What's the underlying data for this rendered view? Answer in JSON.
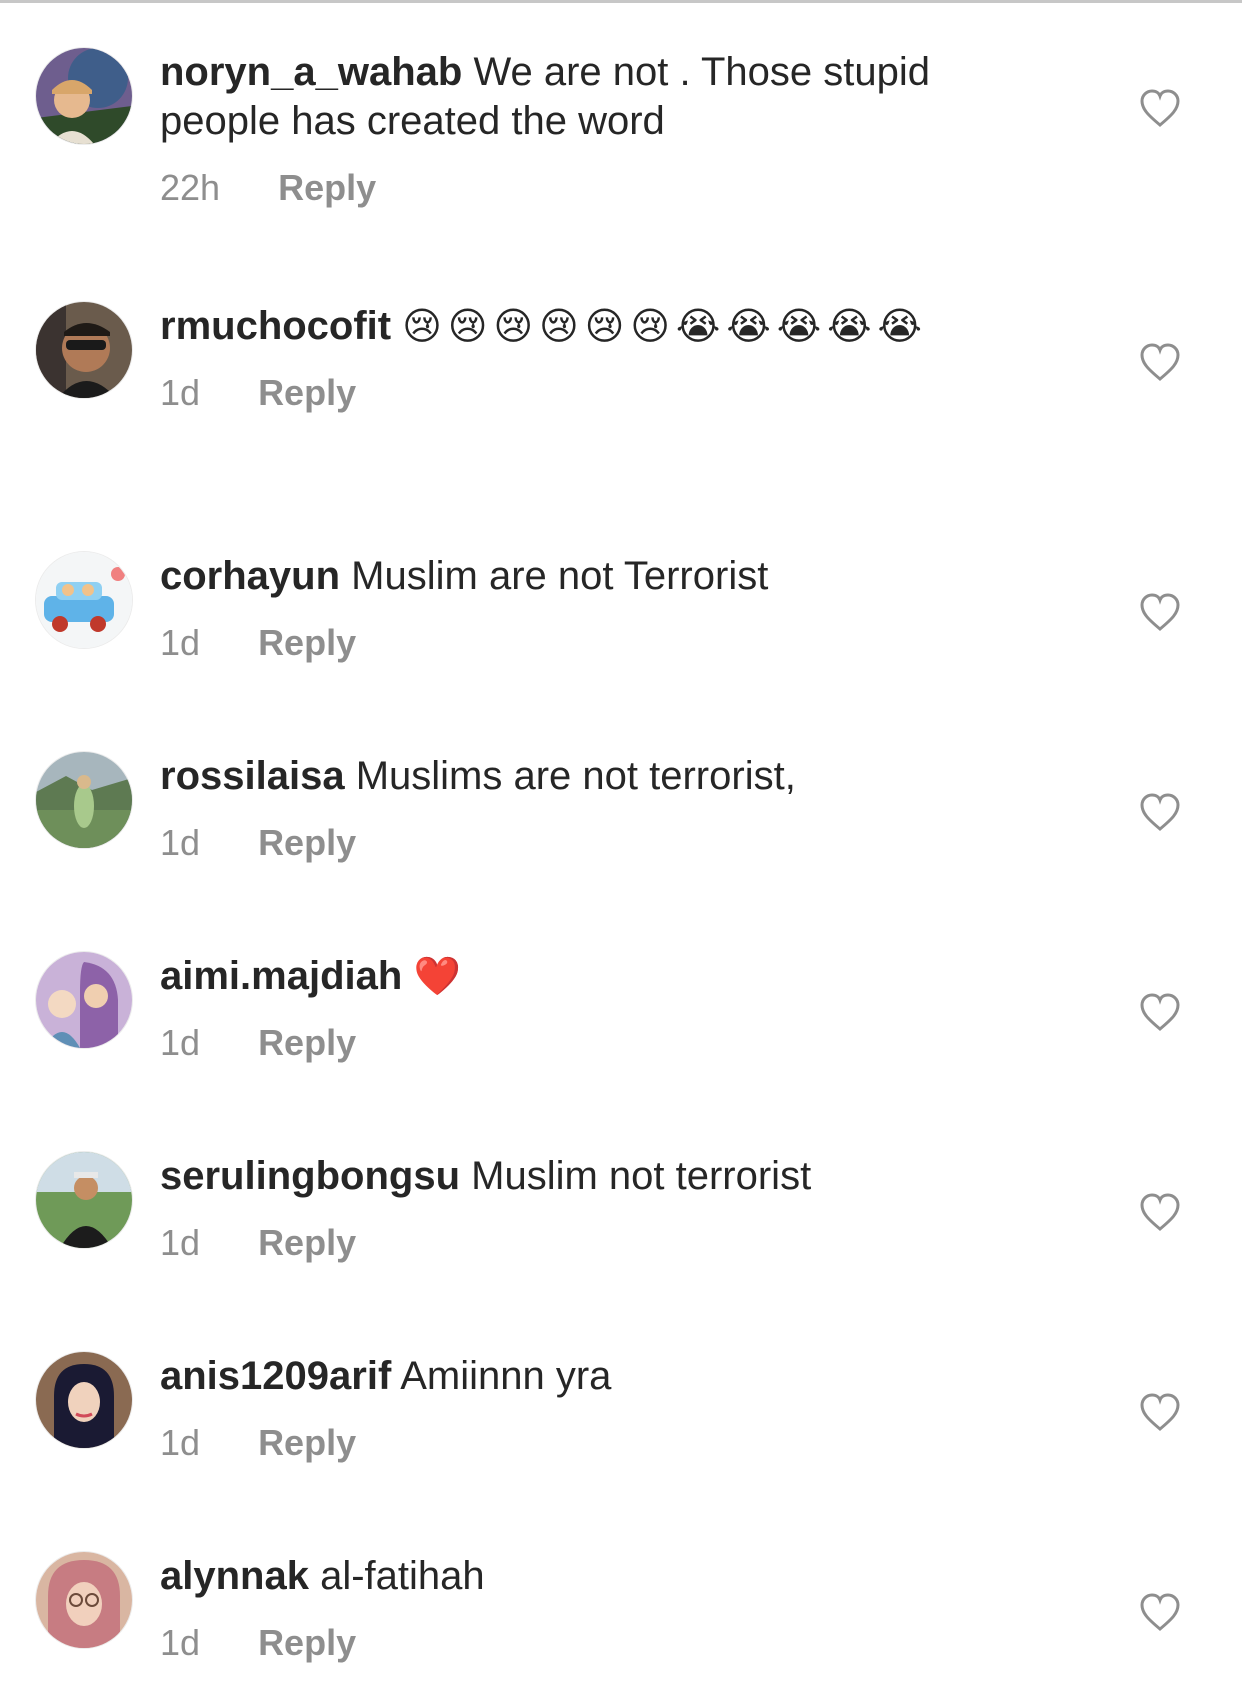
{
  "comments": [
    {
      "username": "noryn_a_wahab",
      "text": "We are not . Those stupid people has created the word",
      "time": "22h",
      "reply_label": "Reply",
      "avatar_colors": [
        "#8a7aa8",
        "#3e5a3a"
      ]
    },
    {
      "username": "rmuchocofit",
      "text": "😢😢😢😢😢😢😭😭😭😭😭",
      "time": "1d",
      "reply_label": "Reply",
      "avatar_colors": [
        "#5a4a40",
        "#2a2a2a"
      ]
    },
    {
      "username": "corhayun",
      "text": "Muslim are not Terrorist",
      "time": "1d",
      "reply_label": "Reply",
      "avatar_colors": [
        "#f3f6f8",
        "#4aa0d8"
      ]
    },
    {
      "username": "rossilaisa",
      "text": "Muslims are not terrorist,",
      "time": "1d",
      "reply_label": "Reply",
      "avatar_colors": [
        "#9fb0b8",
        "#4a6a3a"
      ]
    },
    {
      "username": "aimi.majdiah",
      "text": "❤️",
      "time": "1d",
      "reply_label": "Reply",
      "avatar_colors": [
        "#a58ac0",
        "#6b8fa8"
      ]
    },
    {
      "username": "serulingbongsu",
      "text": "Muslim not terrorist",
      "time": "1d",
      "reply_label": "Reply",
      "avatar_colors": [
        "#4f7a3a",
        "#1f1f1f"
      ]
    },
    {
      "username": "anis1209arif",
      "text": "Amiinnn yra",
      "time": "1d",
      "reply_label": "Reply",
      "avatar_colors": [
        "#7a5a46",
        "#1c1c2e"
      ]
    },
    {
      "username": "alynnak",
      "text": "al-fatihah",
      "time": "1d",
      "reply_label": "Reply",
      "avatar_colors": [
        "#c97f7f",
        "#d8b09a"
      ]
    }
  ],
  "colors": {
    "text": "#262626",
    "secondary": "#8e8e8e",
    "divider": "#c7c7c7"
  }
}
